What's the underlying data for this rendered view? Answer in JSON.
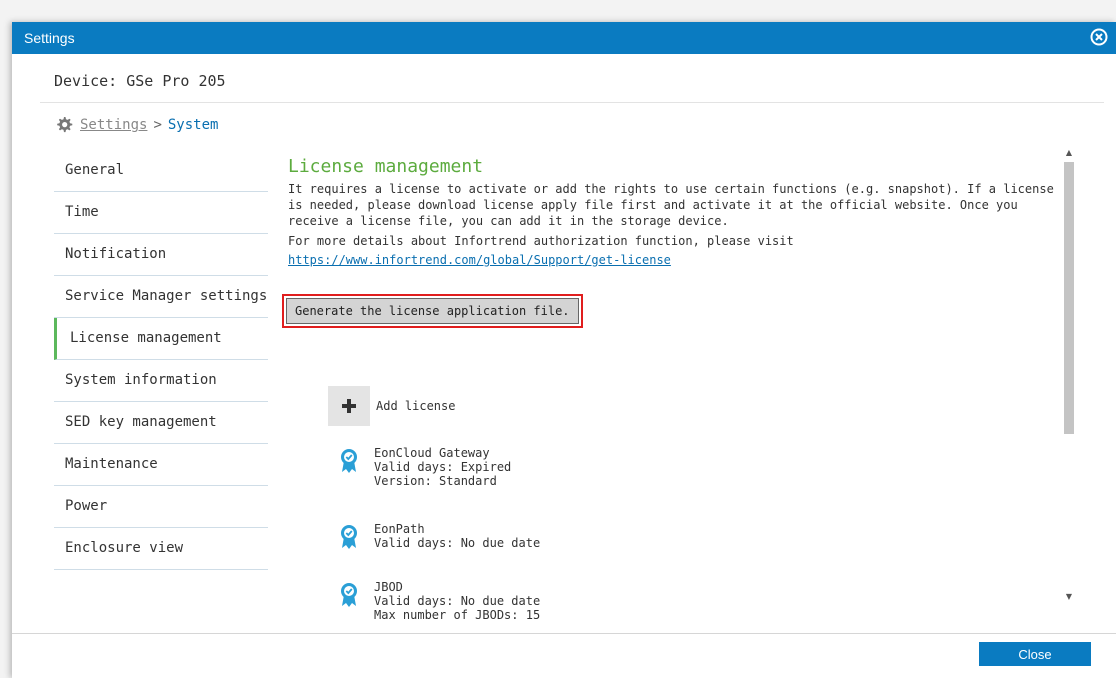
{
  "window": {
    "title": "Settings"
  },
  "device": {
    "label": "Device: GSe Pro 205"
  },
  "breadcrumb": {
    "settings": "Settings",
    "separator": ">",
    "current": "System"
  },
  "sidebar": {
    "items": [
      {
        "label": "General"
      },
      {
        "label": "Time"
      },
      {
        "label": "Notification"
      },
      {
        "label": "Service Manager settings"
      },
      {
        "label": "License management",
        "active": true
      },
      {
        "label": "System information"
      },
      {
        "label": "SED key management"
      },
      {
        "label": "Maintenance"
      },
      {
        "label": "Power"
      },
      {
        "label": "Enclosure view"
      }
    ]
  },
  "content": {
    "title": "License management",
    "description": "It requires a license to activate or add the rights to use certain functions (e.g. snapshot). If a license is needed, please download license apply file first and activate it at the official website. Once you receive a license file, you can add it in the storage device.",
    "details_intro": "For more details about Infortrend authorization function, please visit",
    "link": "https://www.infortrend.com/global/Support/get-license",
    "generate_button": "Generate the license application file.",
    "add_license": "Add license",
    "licenses": [
      {
        "name": "EonCloud Gateway",
        "lines": [
          "Valid days: Expired",
          "Version: Standard"
        ]
      },
      {
        "name": "EonPath",
        "lines": [
          "Valid days: No due date"
        ]
      },
      {
        "name": "JBOD",
        "lines": [
          "Valid days: No due date",
          "Max number of JBODs: 15"
        ]
      }
    ]
  },
  "footer": {
    "close_button": "Close"
  },
  "colors": {
    "titlebar": "#0a7bc1",
    "accent_green": "#5cab3e",
    "link": "#0a6fb0",
    "highlight": "#e01e1e"
  },
  "icons": {
    "close": "close-circle-icon",
    "gear": "gear-icon",
    "add": "plus-icon",
    "license": "ribbon-badge-icon"
  }
}
